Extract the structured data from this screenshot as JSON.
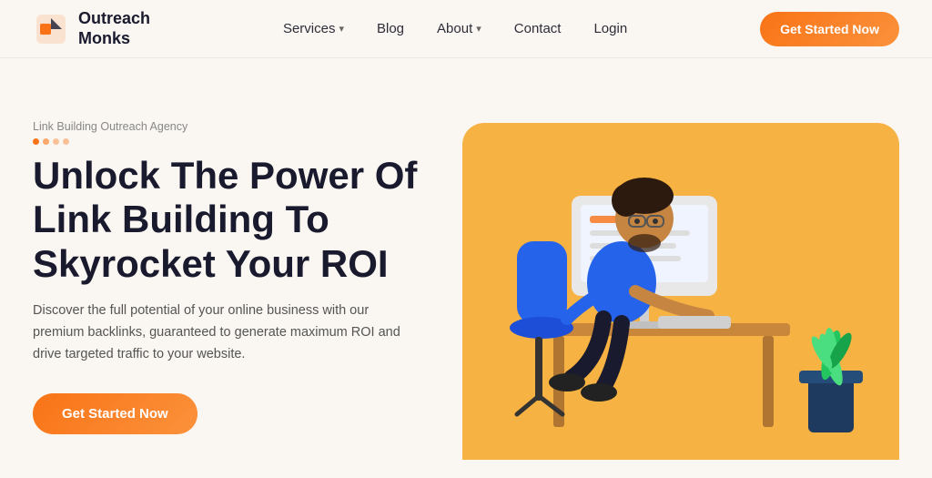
{
  "brand": {
    "name_line1": "Outreach",
    "name_line2": "Monks"
  },
  "nav": {
    "links": [
      {
        "label": "Services",
        "has_dropdown": true
      },
      {
        "label": "Blog",
        "has_dropdown": false
      },
      {
        "label": "About",
        "has_dropdown": true
      },
      {
        "label": "Contact",
        "has_dropdown": false
      },
      {
        "label": "Login",
        "has_dropdown": false
      }
    ],
    "cta_label": "Get Started Now"
  },
  "hero": {
    "tag": "Link Building Outreach Agency",
    "title": "Unlock The Power Of Link Building To Skyrocket Your ROI",
    "description": "Discover the full potential of your online business with our premium backlinks, guaranteed to generate maximum ROI and drive targeted traffic to your website.",
    "cta_label": "Get Started Now"
  }
}
